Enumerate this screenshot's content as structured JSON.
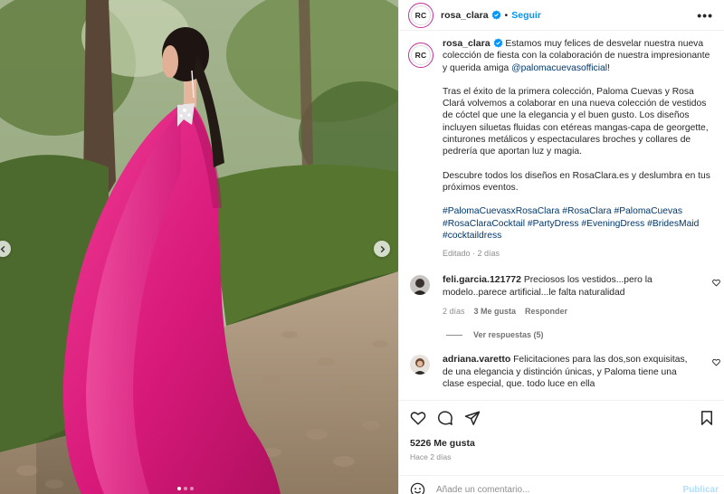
{
  "post": {
    "username": "rosa_clara",
    "avatar_initials": "RC",
    "follow_label": "Seguir",
    "more_label": "•••",
    "separator": "•"
  },
  "caption": {
    "username": "rosa_clara",
    "p1_text": " Estamos muy felices de desvelar nuestra nueva colección de fiesta con la colaboración de nuestra impresionante y querida amiga ",
    "p1_mention": "@palomacuevasofficial",
    "p1_end": "!",
    "p2": "Tras el éxito de la primera colección, Paloma Cuevas y Rosa Clará volvemos a colaborar en una nueva colección de vestidos de cóctel que une la elegancia y el buen gusto. Los diseños incluyen siluetas fluidas con etéreas mangas-capa de georgette, cinturones metálicos y espectaculares broches y collares de pedrería que aportan luz y magia.",
    "p3": "Descubre todos los diseños en RosaClara.es y deslumbra en tus próximos eventos.",
    "hashtags": [
      "#PalomaCuevasxRosaClara",
      "#RosaClara",
      "#PalomaCuevas",
      "#RosaClaraCocktail",
      "#PartyDress",
      "#EveningDress",
      "#BridesMaid",
      "#cocktaildress"
    ],
    "meta": "Editado · 2 días"
  },
  "comments": [
    {
      "username": "feli.garcia.121772",
      "text": " Preciosos los vestidos...pero la modelo..parece artificial...le falta naturalidad",
      "age": "2 días",
      "likes": "3 Me gusta",
      "reply_label": "Responder",
      "view_replies": "Ver respuestas (5)"
    },
    {
      "username": "adriana.varetto",
      "text": " Felicitaciones para las dos,son exquisitas, de una elegancia y distinción únicas, y Paloma tiene una clase especial, que. todo luce en ella"
    }
  ],
  "footer": {
    "likes": "5226 Me gusta",
    "date": "Hace 2 días",
    "comment_placeholder": "Añade un comentario...",
    "publish_label": "Publicar"
  },
  "icons": {
    "like": "heart-icon",
    "comment": "comment-icon",
    "share": "share-icon",
    "save": "bookmark-icon",
    "emoji": "emoji-icon",
    "verified": "verified-badge-icon"
  },
  "colors": {
    "accent": "#0095f6",
    "link": "#00376b",
    "muted": "#8e8e8e",
    "dress": "#d8197a"
  },
  "carousel": {
    "slide_count": 3,
    "active_index": 0
  }
}
